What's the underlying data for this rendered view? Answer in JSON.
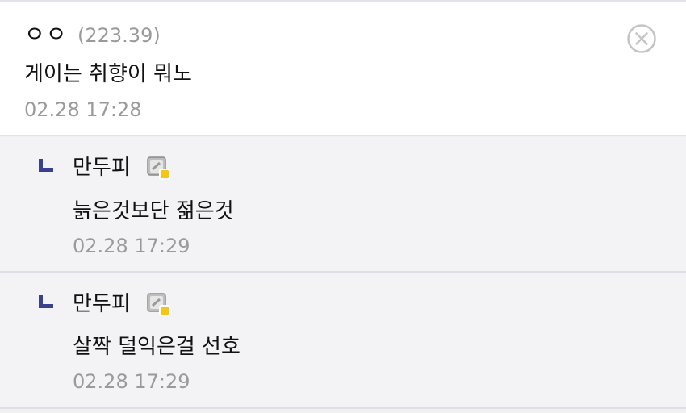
{
  "comment": {
    "nickname": "ㅇㅇ",
    "ip": "(223.39)",
    "text": "게이는 취향이 뭐노",
    "time": "02.28 17:28",
    "close_icon": "close-circle-icon"
  },
  "replies": [
    {
      "nickname": "만두피",
      "text": "늙은것보단 젊은것",
      "time": "02.28 17:29",
      "reply_icon": "reply-corner-icon",
      "member_icon": "gallog-icon"
    },
    {
      "nickname": "만두피",
      "text": "살짝 덜익은걸 선호",
      "time": "02.28 17:29",
      "reply_icon": "reply-corner-icon",
      "member_icon": "gallog-icon"
    }
  ],
  "colors": {
    "reply_mark": "#3b3f8f",
    "meta_gray": "#9a9a9a",
    "reply_bg": "#f3f3f5"
  }
}
